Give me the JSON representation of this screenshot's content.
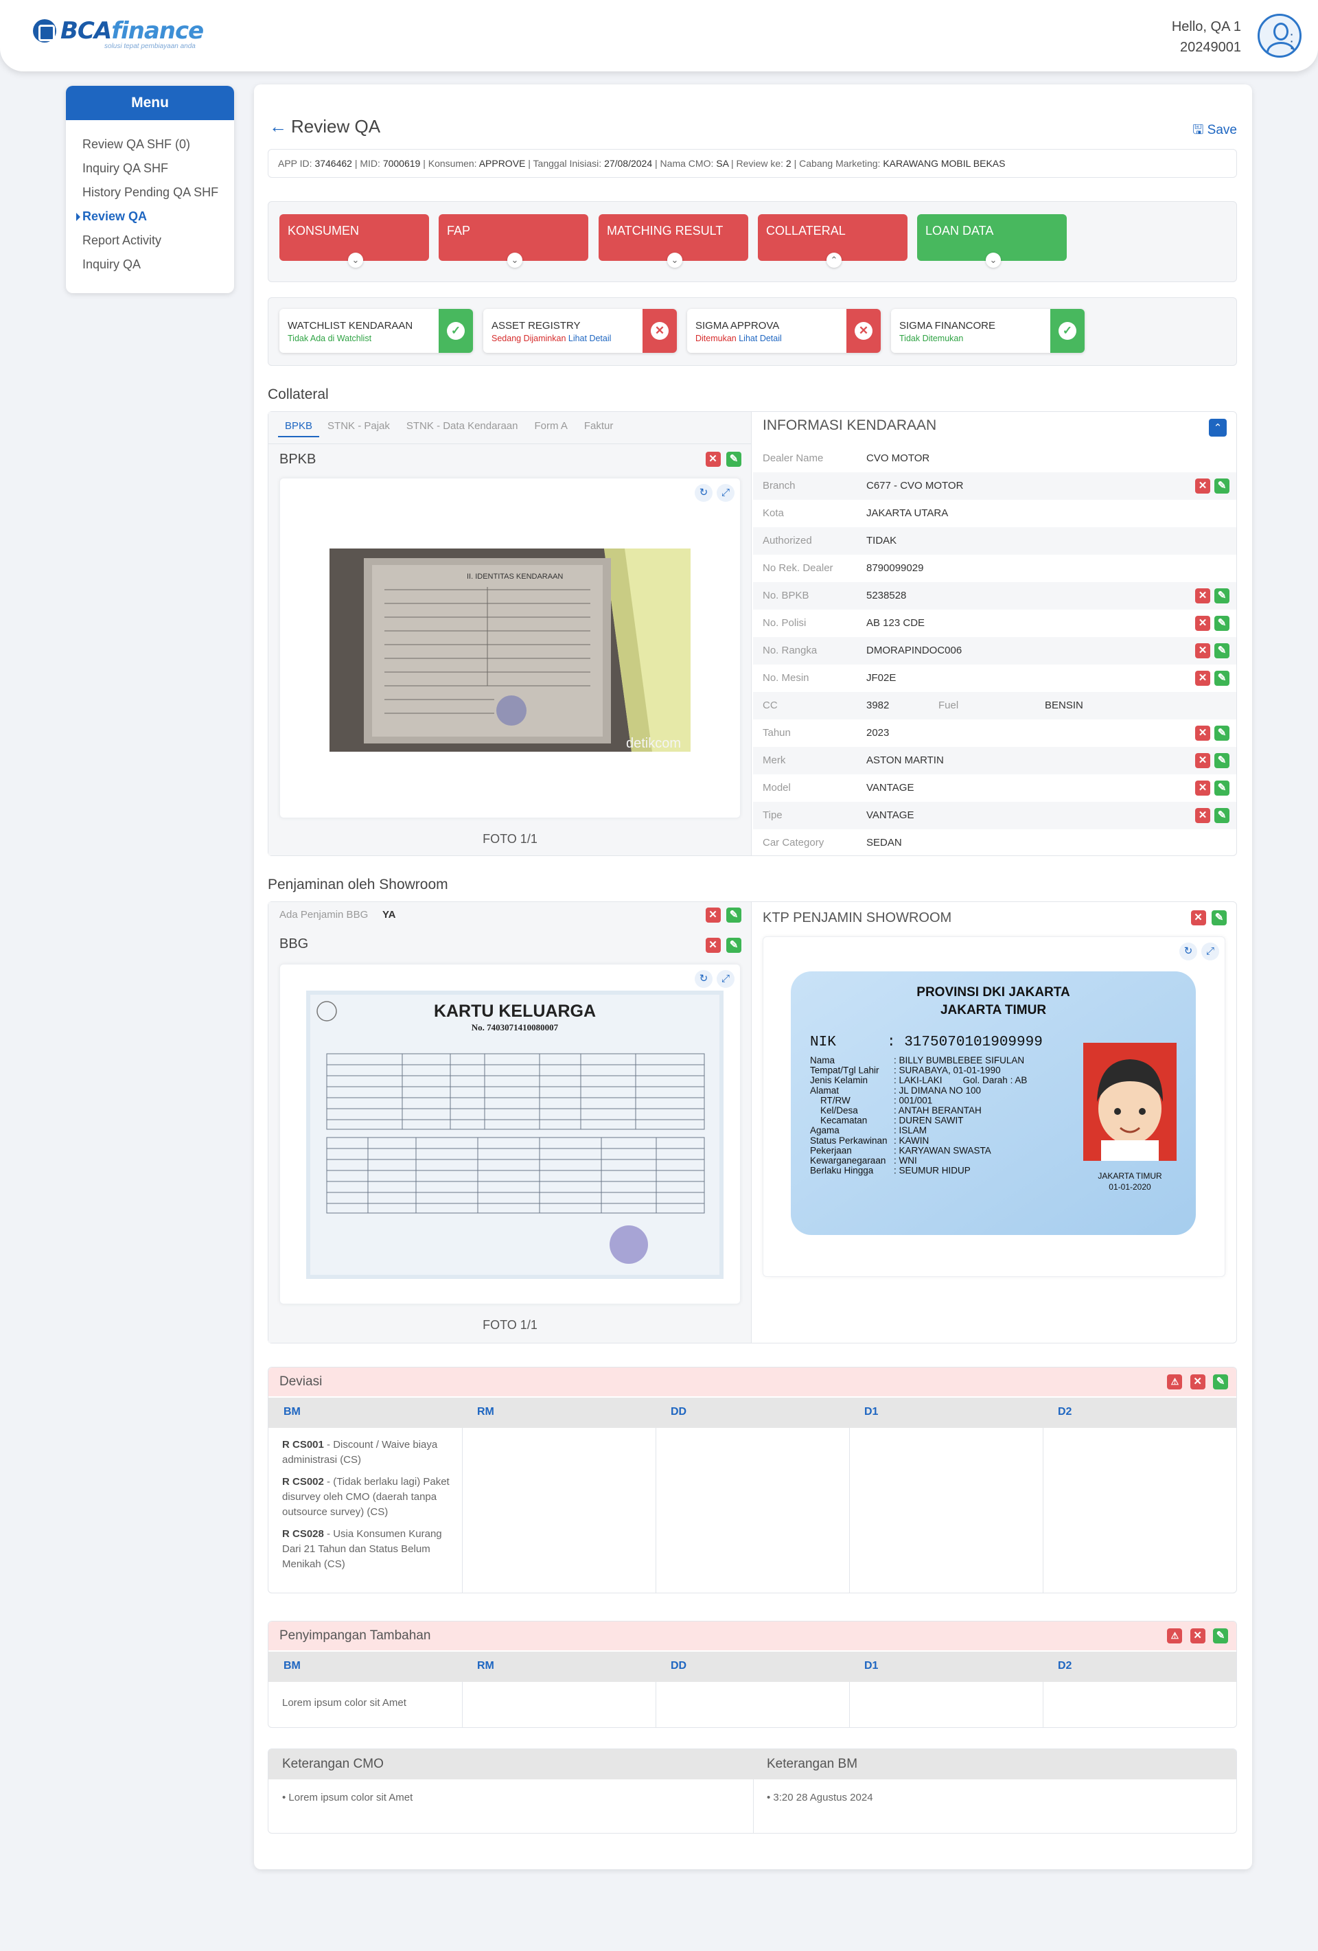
{
  "header": {
    "logo_main": "BCA",
    "logo_sub": "finance",
    "logo_tag": "solusi tepat pembiayaan anda",
    "greeting": "Hello, QA 1",
    "user_id": "20249001"
  },
  "menu": {
    "title": "Menu",
    "items": [
      "Review QA SHF (0)",
      "Inquiry QA SHF",
      "History Pending QA SHF",
      "Review QA",
      "Report Activity",
      "Inquiry QA"
    ]
  },
  "page": {
    "back": "←",
    "title": "Review QA",
    "save": "🖫 Save"
  },
  "app_info": {
    "app_id_label": "APP ID: ",
    "app_id": "3746462",
    "mid_label": " | MID: ",
    "mid": "7000619",
    "konsumen_label": " | Konsumen: ",
    "konsumen": "APPROVE",
    "tgl_label": " | Tanggal Inisiasi: ",
    "tgl": "27/08/2024",
    "cmo_label": " | Nama CMO: ",
    "cmo": "SA",
    "review_label": " | Review ke: ",
    "review": "2",
    "cabang_label": " | Cabang Marketing: ",
    "cabang": "KARAWANG MOBIL BEKAS"
  },
  "tabs": [
    {
      "label": "KONSUMEN",
      "chev": "⌄"
    },
    {
      "label": "FAP",
      "chev": "⌄"
    },
    {
      "label": "MATCHING RESULT",
      "chev": "⌄"
    },
    {
      "label": "COLLATERAL",
      "chev": "⌃"
    },
    {
      "label": "LOAN DATA",
      "chev": "⌄"
    }
  ],
  "checks": [
    {
      "title": "WATCHLIST KENDARAAN",
      "status": "Tidak Ada di Watchlist",
      "link": "",
      "icon": "✓"
    },
    {
      "title": "ASSET REGISTRY",
      "status": "Sedang Dijaminkan ",
      "link": "Lihat Detail",
      "icon": "✕"
    },
    {
      "title": "SIGMA APPROVA",
      "status": "Ditemukan ",
      "link": "Lihat Detail",
      "icon": "✕"
    },
    {
      "title": "SIGMA FINANCORE",
      "status": "Tidak Ditemukan",
      "link": "",
      "icon": "✓"
    }
  ],
  "collateral": {
    "title": "Collateral",
    "subtabs": [
      "BPKB",
      "STNK - Pajak",
      "STNK - Data Kendaraan",
      "Form A",
      "Faktur"
    ],
    "doc_title": "BPKB",
    "foto": "FOTO 1/1",
    "watermark": "detikcom",
    "bpkb_doc_title": "II. IDENTITAS KENDARAAN"
  },
  "vehicle": {
    "title": "INFORMASI KENDARAAN",
    "rows": [
      {
        "k": "Dealer Name",
        "v": "CVO MOTOR"
      },
      {
        "k": "Branch",
        "v": "C677 - CVO MOTOR"
      },
      {
        "k": "Kota",
        "v": "JAKARTA UTARA"
      },
      {
        "k": "Authorized",
        "v": "TIDAK"
      },
      {
        "k": "No Rek. Dealer",
        "v": "8790099029"
      },
      {
        "k": "No. BPKB",
        "v": "5238528"
      },
      {
        "k": "No. Polisi",
        "v": "AB 123 CDE"
      },
      {
        "k": "No. Rangka",
        "v": "DMORAPINDOC006"
      },
      {
        "k": "No. Mesin",
        "v": "JF02E"
      },
      {
        "k": "CC",
        "v": "3982",
        "k2": "Fuel",
        "v2": "BENSIN"
      },
      {
        "k": "Tahun",
        "v": "2023"
      },
      {
        "k": "Merk",
        "v": "ASTON MARTIN"
      },
      {
        "k": "Model",
        "v": "VANTAGE"
      },
      {
        "k": "Tipe",
        "v": "VANTAGE"
      },
      {
        "k": "Car Category",
        "v": "SEDAN"
      }
    ]
  },
  "showroom": {
    "title": "Penjaminan oleh Showroom",
    "bbg_label": "Ada Penjamin BBG",
    "bbg_value": "YA",
    "bbg_title": "BBG",
    "foto": "FOTO 1/1",
    "ktp_title": "KTP PENJAMIN SHOWROOM"
  },
  "kk": {
    "title": "KARTU KELUARGA",
    "no": "No. 7403071410080007"
  },
  "ktp": {
    "prov": "PROVINSI DKI JAKARTA",
    "kota": "JAKARTA TIMUR",
    "nik_label": "NIK",
    "nik": ": 3175070101909999",
    "fields": [
      [
        "Nama",
        ": BILLY BUMBLEBEE SIFULAN"
      ],
      [
        "Tempat/Tgl Lahir",
        ": SURABAYA, 01-01-1990"
      ],
      [
        "Jenis Kelamin",
        ": LAKI-LAKI        Gol. Darah : AB"
      ],
      [
        "Alamat",
        ": JL DIMANA NO 100"
      ],
      [
        "    RT/RW",
        ": 001/001"
      ],
      [
        "    Kel/Desa",
        ": ANTAH BERANTAH"
      ],
      [
        "    Kecamatan",
        ": DUREN SAWIT"
      ],
      [
        "Agama",
        ": ISLAM"
      ],
      [
        "Status Perkawinan",
        ": KAWIN"
      ],
      [
        "Pekerjaan",
        ": KARYAWAN SWASTA"
      ],
      [
        "Kewarganegaraan",
        ": WNI"
      ],
      [
        "Berlaku Hingga",
        ": SEUMUR HIDUP"
      ]
    ],
    "sign_city": "JAKARTA TIMUR",
    "sign_date": "01-01-2020"
  },
  "deviasi": {
    "title": "Deviasi",
    "cols": [
      "BM",
      "RM",
      "DD",
      "D1",
      "D2"
    ],
    "items": [
      {
        "code": "R CS001",
        "text": " - Discount / Waive biaya administrasi (CS)"
      },
      {
        "code": "R CS002",
        "text": " - (Tidak berlaku lagi) Paket disurvey oleh CMO (daerah tanpa outsource survey) (CS)"
      },
      {
        "code": "R CS028",
        "text": " - Usia Konsumen Kurang Dari 21 Tahun dan Status Belum Menikah (CS)"
      }
    ]
  },
  "penyimpangan": {
    "title": "Penyimpangan Tambahan",
    "cols": [
      "BM",
      "RM",
      "DD",
      "D1",
      "D2"
    ],
    "item": "Lorem ipsum color sit Amet"
  },
  "keterangan": {
    "cmo_title": "Keterangan CMO",
    "bm_title": "Keterangan BM",
    "cmo_item": "• Lorem ipsum color sit Amet",
    "bm_item": "• 3:20 28 Agustus 2024"
  },
  "icons": {
    "close": "✕",
    "edit": "✎",
    "warn": "⚠",
    "refresh": "↻",
    "expand": "⤢",
    "collapse": "⌃"
  },
  "colors": {
    "primary": "#1e66c1",
    "red": "#dd4e51",
    "green": "#48b85e",
    "pink": "#fde4e4"
  }
}
